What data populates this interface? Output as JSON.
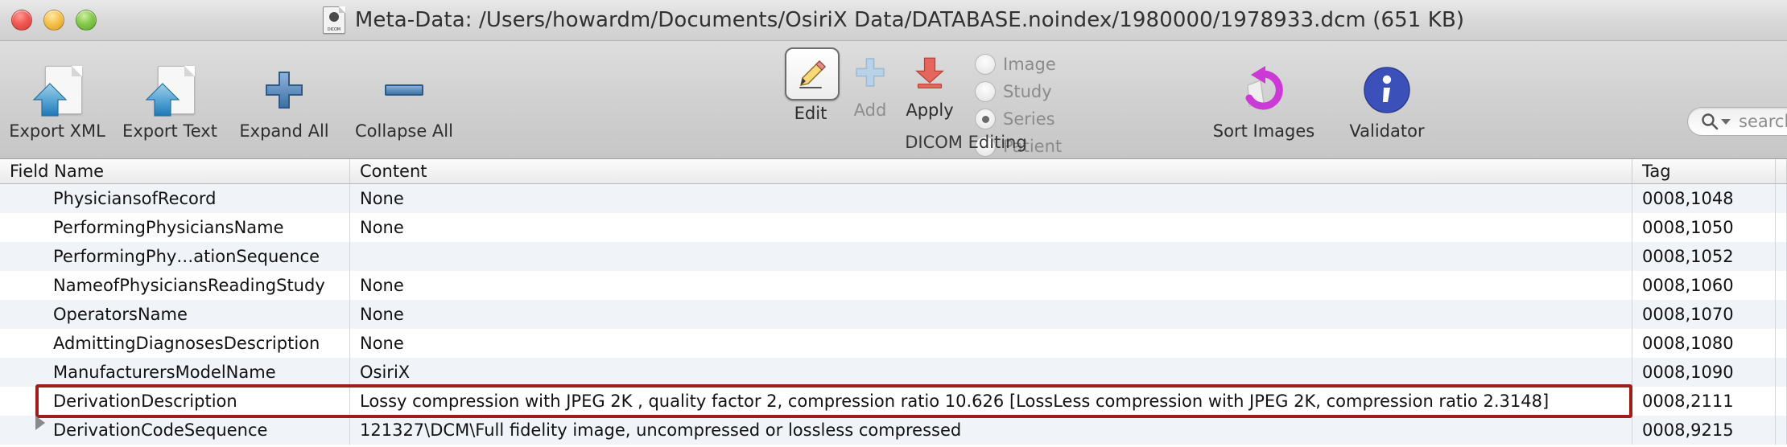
{
  "window": {
    "title": "Meta-Data:  /Users/howardm/Documents/OsiriX Data/DATABASE.noindex/1980000/1978933.dcm (651 KB)",
    "doc_icon_label": "DICOM",
    "traffic_lights": [
      "close",
      "minimize",
      "zoom"
    ]
  },
  "toolbar": {
    "items": [
      {
        "label": "Export XML",
        "icon": "document-upload-icon"
      },
      {
        "label": "Export Text",
        "icon": "document-upload-icon"
      },
      {
        "label": "Expand All",
        "icon": "plus-icon"
      },
      {
        "label": "Collapse All",
        "icon": "minus-icon"
      }
    ],
    "dicom_editing": {
      "caption": "DICOM Editing",
      "buttons": [
        {
          "label": "Edit",
          "icon": "pencil-icon",
          "selected": true,
          "enabled": true
        },
        {
          "label": "Add",
          "icon": "plus-icon",
          "selected": false,
          "enabled": false
        },
        {
          "label": "Apply",
          "icon": "download-arrow-icon",
          "selected": false,
          "enabled": true
        }
      ],
      "scope_options": [
        {
          "label": "Image",
          "selected": false
        },
        {
          "label": "Study",
          "selected": false
        },
        {
          "label": "Series",
          "selected": true
        },
        {
          "label": "Patient",
          "selected": false
        }
      ]
    },
    "right_items": [
      {
        "label": "Sort Images",
        "icon": "sort-rotate-icon"
      },
      {
        "label": "Validator",
        "icon": "info-icon"
      }
    ],
    "search": {
      "placeholder": "search",
      "icon": "search-icon"
    }
  },
  "table": {
    "columns": [
      "Field Name",
      "Content",
      "Tag"
    ],
    "rows": [
      {
        "name": "PhysiciansofRecord",
        "content": "None",
        "tag": "0008,1048",
        "expandable": false,
        "highlighted": false
      },
      {
        "name": "PerformingPhysiciansName",
        "content": "None",
        "tag": "0008,1050",
        "expandable": false,
        "highlighted": false
      },
      {
        "name": "PerformingPhy…ationSequence",
        "content": "",
        "tag": "0008,1052",
        "expandable": false,
        "highlighted": false
      },
      {
        "name": "NameofPhysiciansReadingStudy",
        "content": "None",
        "tag": "0008,1060",
        "expandable": false,
        "highlighted": false
      },
      {
        "name": "OperatorsName",
        "content": "None",
        "tag": "0008,1070",
        "expandable": false,
        "highlighted": false
      },
      {
        "name": "AdmittingDiagnosesDescription",
        "content": "None",
        "tag": "0008,1080",
        "expandable": false,
        "highlighted": false
      },
      {
        "name": "ManufacturersModelName",
        "content": "OsiriX",
        "tag": "0008,1090",
        "expandable": false,
        "highlighted": false
      },
      {
        "name": "DerivationDescription",
        "content": "Lossy compression with JPEG 2K , quality factor 2, compression ratio 10.626 [LossLess compression with JPEG 2K, compression ratio 2.3148]",
        "tag": "0008,2111",
        "expandable": false,
        "highlighted": true
      },
      {
        "name": "DerivationCodeSequence",
        "content": "121327\\DCM\\Full fidelity image, uncompressed or lossless compressed",
        "tag": "0008,9215",
        "expandable": true,
        "highlighted": false
      }
    ]
  },
  "colors": {
    "highlight_border": "#9c1f1a",
    "row_stripe": "#f0f4f9",
    "accent_blue": "#3b6fb5",
    "apply_red": "#e06a60",
    "sort_purple": "#c83ad0"
  }
}
